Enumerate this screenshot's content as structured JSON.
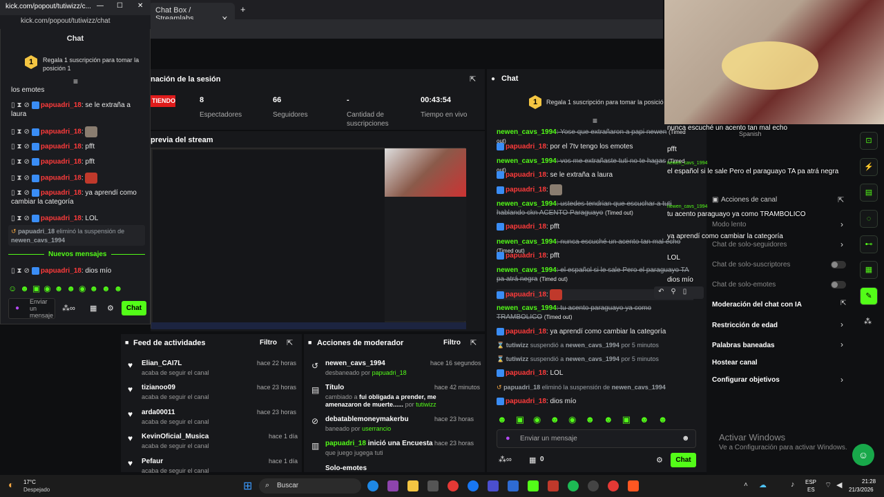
{
  "browser": {
    "tab1": "Chat Box / Streamlabs",
    "new_tab": "+"
  },
  "popout": {
    "window_title": "kick.com/popout/tutiwizz/c...",
    "url": "kick.com/popout/tutiwizz/chat",
    "header": "Chat",
    "gift_rank": "1",
    "gift_text": "Regala 1 suscripción para tomar la posición 1",
    "messages": [
      {
        "user": "",
        "text": "los emotes"
      },
      {
        "user": "papuadri_18",
        "text": ": se le extraña a laura"
      },
      {
        "user": "papuadri_18",
        "text": ":"
      },
      {
        "user": "papuadri_18",
        "text": ": pfft"
      },
      {
        "user": "papuadri_18",
        "text": ": pfft"
      },
      {
        "user": "papuadri_18",
        "text": ":"
      },
      {
        "user": "papuadri_18",
        "text": ": ya aprendí como cambiar la categoría"
      },
      {
        "user": "papuadri_18",
        "text": ": LOL"
      }
    ],
    "unban_notice_user": "papuadri_18",
    "unban_notice_text": "eliminó la suspensión de",
    "unban_notice_target": "newen_cavs_1994",
    "new_messages": "Nuevos mensajes",
    "last_user": "papuadri_18",
    "last_text": ": dios mío",
    "input_placeholder": "Enviar un mensaje",
    "chat_button": "Chat"
  },
  "dashboard": {
    "session_title": "nación de la sesión",
    "live_badge": "TIENDO",
    "stats": [
      {
        "value": "8",
        "label": "Espectadores"
      },
      {
        "value": "66",
        "label": "Seguidores"
      },
      {
        "value": "-",
        "label": "Cantidad de suscripciones"
      },
      {
        "value": "00:43:54",
        "label": "Tiempo en vivo"
      }
    ],
    "preview_title": "previa del stream",
    "feed": {
      "title": "Feed de actividades",
      "filter": "Filtro",
      "items": [
        {
          "name": "Elian_CAI7L",
          "sub": "acaba de seguir el canal",
          "time": "hace 22 horas"
        },
        {
          "name": "tizianoo09",
          "sub": "acaba de seguir el canal",
          "time": "hace 23 horas"
        },
        {
          "name": "arda00011",
          "sub": "acaba de seguir el canal",
          "time": "hace 23 horas"
        },
        {
          "name": "KevinOficial_Musica",
          "sub": "acaba de seguir el canal",
          "time": "hace 1 día"
        },
        {
          "name": "Pefaur",
          "sub": "acaba de seguir el canal",
          "time": "hace 1 día"
        }
      ]
    },
    "mod": {
      "title": "Acciones de moderador",
      "filter": "Filtro",
      "items": [
        {
          "name": "newen_cavs_1994",
          "sub": "desbaneado por",
          "by": "papuadri_18",
          "time": "hace 16 segundos"
        },
        {
          "name": "Título",
          "sub": "cambiado a",
          "bold": "fui obligada a prender, me amenazaron de muerte......",
          "by_pre": "por",
          "by": "tutiwizz",
          "time": "hace 42 minutos"
        },
        {
          "name": "debatablemoneymakerbu",
          "sub": "baneado por",
          "by": "userrancio",
          "time": "hace 23 horas"
        },
        {
          "name": "papuadri_18",
          "name_rest": "inició una Encuesta",
          "sub": "que juego jugega tuti",
          "time": "hace 23 horas"
        },
        {
          "name": "Solo-emotes",
          "sub": "",
          "time": ""
        }
      ]
    }
  },
  "chat": {
    "title": "Chat",
    "gift_rank": "1",
    "gift_text": "Regala 1 suscripción para tomar la posición 1",
    "messages": [
      {
        "user": "newen_cavs_1994",
        "text": ": Yose que extrañaron a papi newen",
        "timed": "(Timed out)"
      },
      {
        "user": "papuadri_18",
        "text": ": por el 7tv tengo los emotes"
      },
      {
        "user": "newen_cavs_1994",
        "text": ": vos me extrañaste tuti no te hagas",
        "timed": "(Timed out)"
      },
      {
        "user": "papuadri_18",
        "text": ": se le extraña a laura"
      },
      {
        "user": "papuadri_18",
        "text": ":"
      },
      {
        "user": "newen_cavs_1994",
        "text": ": ustedes tendrian que escuchar a tuti hablando ckn ACENTO Paraguayo",
        "timed": "(Timed out)"
      },
      {
        "user": "papuadri_18",
        "text": ": pfft"
      },
      {
        "user": "newen_cavs_1994",
        "text": ": nunca escuché un acento tan mal echo",
        "timed": "(Timed out)"
      },
      {
        "user": "papuadri_18",
        "text": ": pfft"
      },
      {
        "user": "newen_cavs_1994",
        "text": ": el español si le sale Pero el paraguayo TA pa atrá negra",
        "timed": "(Timed out)"
      },
      {
        "user": "papuadri_18",
        "text": ":"
      },
      {
        "user": "newen_cavs_1994",
        "text": ": tu acento paraguayo ya como TRAMBOLICO",
        "timed": "(Timed out)"
      },
      {
        "user": "papuadri_18",
        "text": ": ya aprendí como cambiar la categoría"
      },
      {
        "user": "tutiwizz",
        "text": "suspendió a",
        "target": "newen_cavs_1994",
        "suffix": "por 5 minutos"
      },
      {
        "user": "tutiwizz",
        "text": "suspendió a",
        "target": "newen_cavs_1994",
        "suffix": "por 5 minutos"
      },
      {
        "user": "papuadri_18",
        "text": ": LOL"
      },
      {
        "user": "papuadri_18",
        "text": "eliminó la suspensión de",
        "target": "newen_cavs_1994"
      },
      {
        "user": "papuadri_18",
        "text": ": dios mío"
      }
    ],
    "input_placeholder": "Enviar un mensaje",
    "points": "0",
    "chat_button": "Chat"
  },
  "overlay": {
    "lines": [
      {
        "user": "",
        "text": "nunca escuché un acento tan mal echo"
      },
      {
        "user": "",
        "text": "Spanish"
      },
      {
        "user": "",
        "text": "pfft"
      },
      {
        "user": "newen_cavs_1994",
        "text": "el español si le sale Pero el paraguayo TA pa atrá negra"
      },
      {
        "user": "newen_cavs_1994",
        "text": "tu acento paraguayo ya como TRAMBOLICO"
      },
      {
        "user": "",
        "text": "ya aprendí como cambiar la categoría"
      },
      {
        "user": "",
        "text": "LOL"
      },
      {
        "user": "",
        "text": "dios mío"
      }
    ],
    "channel_actions": "Acciones de canal",
    "menu": [
      {
        "label": "Modo lento",
        "dim": true
      },
      {
        "label": "Chat de solo-seguidores",
        "dim": true
      },
      {
        "label": "Chat de solo-suscriptores",
        "dim": true
      },
      {
        "label": "Chat de solo-emotes",
        "dim": true
      },
      {
        "label": "Moderación del chat con IA",
        "dim": false
      },
      {
        "label": "Restricción de edad",
        "dim": false
      },
      {
        "label": "Palabras baneadas",
        "dim": false
      },
      {
        "label": "Hostear canal",
        "dim": false
      },
      {
        "label": "Configurar objetivos",
        "dim": false
      }
    ],
    "activate_title": "Activar Windows",
    "activate_sub": "Ve a Configuración para activar Windows."
  },
  "taskbar": {
    "temp": "17°C",
    "weather": "Despejado",
    "search": "Buscar",
    "lang1": "ESP",
    "lang2": "ES",
    "time": "21:28",
    "date": "21/3/2026"
  }
}
